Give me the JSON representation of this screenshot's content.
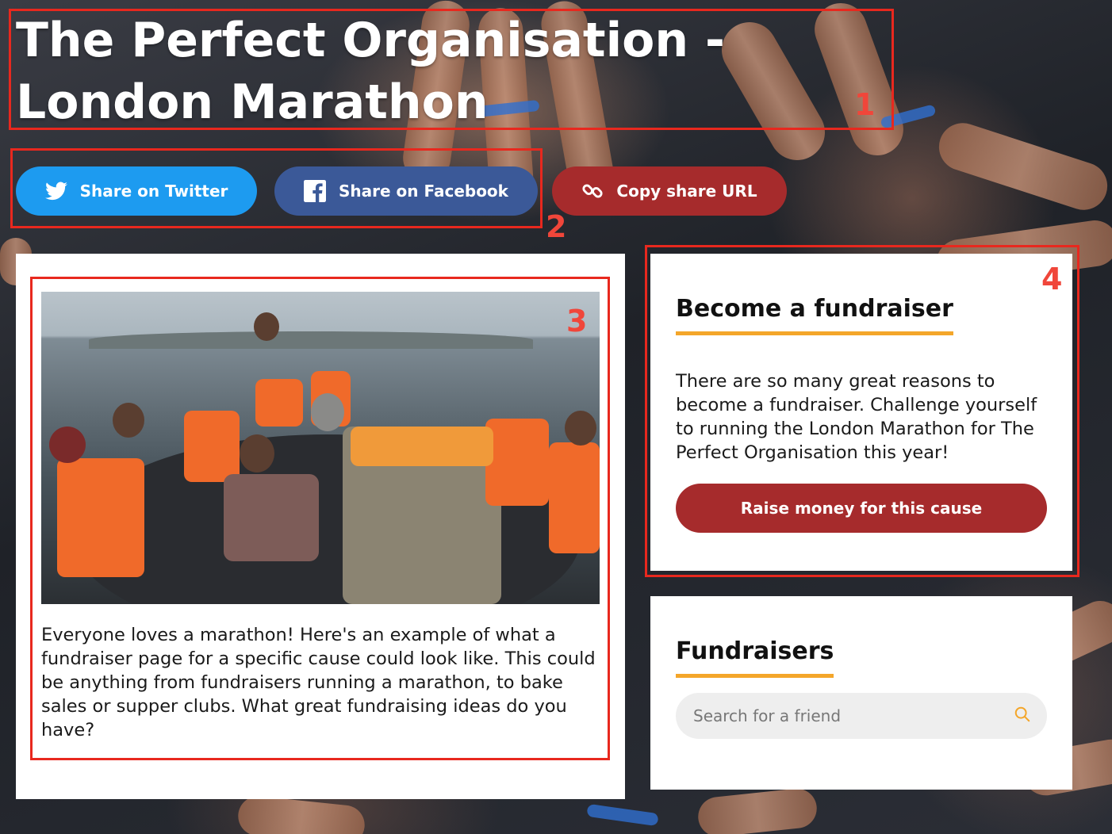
{
  "page": {
    "title": "The Perfect Organisation - London Marathon"
  },
  "share": {
    "twitter_label": "Share on Twitter",
    "facebook_label": "Share on Facebook",
    "copy_label": "Copy share URL"
  },
  "story": {
    "body": "Everyone loves a marathon! Here's an example of what a fundraiser page for a specific cause could look like. This could be anything from fundraisers running a marathon, to bake sales or supper clubs. What great fundraising ideas do you have?"
  },
  "become_fundraiser": {
    "heading": "Become a fundraiser",
    "text": "There are so many great reasons to become a fundraiser. Challenge yourself to running the London Marathon for The Perfect Organisation this year!",
    "button_label": "Raise money for this cause"
  },
  "fundraisers": {
    "heading": "Fundraisers",
    "search_placeholder": "Search for a friend"
  },
  "annotations": [
    "1",
    "2",
    "3",
    "4"
  ],
  "colors": {
    "twitter": "#1d9bf0",
    "facebook": "#3b5998",
    "brand_red": "#a62b2c",
    "accent_orange": "#f4a62a",
    "annotation_red": "#e8281e"
  },
  "icons": [
    "twitter-icon",
    "facebook-icon",
    "link-icon",
    "search-icon"
  ]
}
